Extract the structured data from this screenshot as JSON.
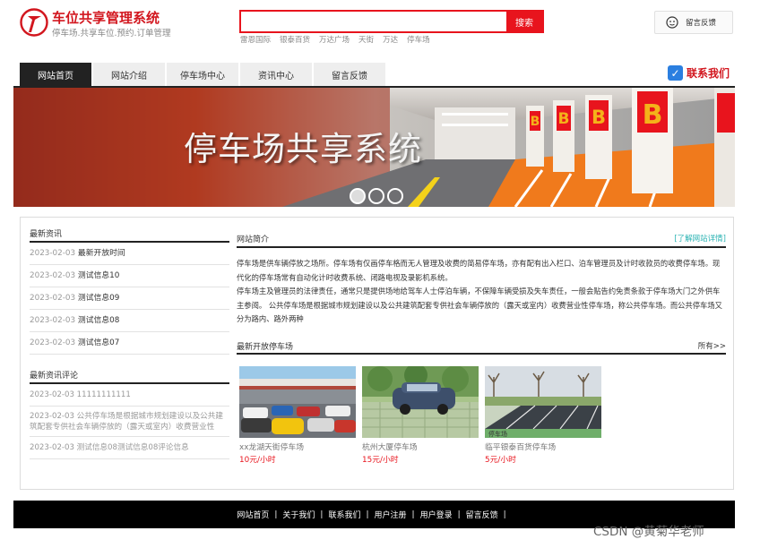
{
  "header": {
    "site_title": "车位共享管理系统",
    "site_subtitle": "停车场.共享车位.预约.订单管理",
    "search_placeholder": "",
    "search_button": "搜索",
    "hot_words": [
      "雷恩国际",
      "银泰百货",
      "万达广场",
      "天街",
      "万达",
      "停车场"
    ],
    "feedback_button": "留言反馈",
    "colors": {
      "accent": "#e8141d",
      "brand": "#d2161e"
    }
  },
  "nav": {
    "items": [
      "网站首页",
      "网站介绍",
      "停车场中心",
      "资讯中心",
      "留言反馈"
    ],
    "active_index": 0,
    "contact_label": "联系我们",
    "contact_icon": "check-icon"
  },
  "banner": {
    "title": "停车场共享系统",
    "slide_count": 3,
    "active_slide": 0
  },
  "latest_news": {
    "title": "最新资讯",
    "items": [
      {
        "date": "2023-02-03",
        "title": "最新开放时间"
      },
      {
        "date": "2023-02-03",
        "title": "测试信息10"
      },
      {
        "date": "2023-02-03",
        "title": "测试信息09"
      },
      {
        "date": "2023-02-03",
        "title": "测试信息08"
      },
      {
        "date": "2023-02-03",
        "title": "测试信息07"
      }
    ]
  },
  "latest_comments": {
    "title": "最新资讯评论",
    "items": [
      "2023-02-03 11111111111",
      "2023-02-03 公共停车场是根据城市规划建设以及公共建筑配套专供社会车辆停放的（露天或室内）收费营业性",
      "2023-02-03 测试信息08测试信息08评论信息"
    ]
  },
  "intro": {
    "title": "网站简介",
    "more_link": "[了解网站详情]",
    "paragraphs": [
      "停车场是供车辆停放之场所。停车场有仅画停车格而无人管理及收费的简易停车场，亦有配有出入栏口、泊车管理员及计时收款员的收费停车场。现代化的停车场常有自动化计时收费系统、闭路电视及录影机系统。",
      "停车场主及管理员的法律责任，通常只是提供场地给驾车人士停泊车辆，不保障车辆受损及失车责任，一般会贴告约免责条款于停车场大门之外供车主参阅。 公共停车场是根据城市规划建设以及公共建筑配套专供社会车辆停放的（露天或室内）收费营业性停车场，称公共停车场。而公共停车场又分为路内、路外两种"
    ]
  },
  "parking": {
    "title": "最新开放停车场",
    "more_link": "所有>>",
    "lots": [
      {
        "name": "xx龙湖天街停车场",
        "price": "10元/小时"
      },
      {
        "name": "杭州大厦停车场",
        "price": "15元/小时"
      },
      {
        "name": "临平银泰百货停车场",
        "price": "5元/小时"
      }
    ]
  },
  "footer": {
    "links": [
      "网站首页",
      "关于我们",
      "联系我们",
      "用户注册",
      "用户登录",
      "留言反馈"
    ],
    "separator": "|"
  },
  "watermark": "CSDN @黄菊华老师"
}
